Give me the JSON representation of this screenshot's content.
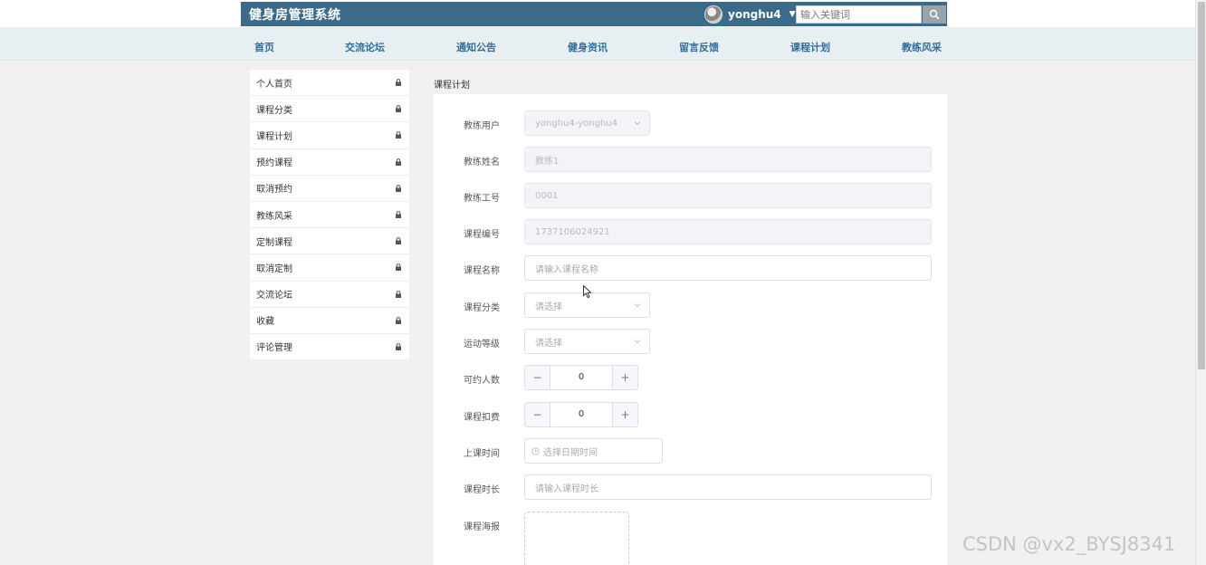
{
  "header": {
    "app_title": "健身房管理系统",
    "username": "yonghu4",
    "search_placeholder": "输入关键词",
    "icons": [
      "avatar",
      "caret-down-icon",
      "search-icon"
    ]
  },
  "nav": {
    "items": [
      "首页",
      "交流论坛",
      "通知公告",
      "健身资讯",
      "留言反馈",
      "课程计划",
      "教练风采"
    ]
  },
  "sidebar": {
    "items": [
      "个人首页",
      "课程分类",
      "课程计划",
      "预约课程",
      "取消预约",
      "教练风采",
      "定制课程",
      "取消定制",
      "交流论坛",
      "收藏",
      "评论管理"
    ],
    "item_icon": "lock-icon"
  },
  "breadcrumb": "课程计划",
  "form": {
    "coach_user": {
      "label": "教练用户",
      "value": "yonghu4-yonghu4"
    },
    "coach_name": {
      "label": "教练姓名",
      "value": "教练1"
    },
    "coach_id": {
      "label": "教练工号",
      "value": "0001"
    },
    "course_no": {
      "label": "课程编号",
      "value": "1737106024921"
    },
    "course_name": {
      "label": "课程名称",
      "placeholder": "请输入课程名称"
    },
    "course_category": {
      "label": "课程分类",
      "placeholder": "请选择"
    },
    "sport_level": {
      "label": "运动等级",
      "placeholder": "请选择"
    },
    "capacity": {
      "label": "可约人数",
      "value": "0",
      "minus": "−",
      "plus": "+"
    },
    "course_fee": {
      "label": "课程扣费",
      "value": "0",
      "minus": "−",
      "plus": "+"
    },
    "class_time": {
      "label": "上课时间",
      "placeholder": "选择日期时间"
    },
    "duration": {
      "label": "课程时长",
      "placeholder": "请输入课程时长"
    },
    "poster": {
      "label": "课程海报"
    }
  },
  "watermark": "CSDN @vx2_BYSJ8341",
  "colors": {
    "header_bg": "#3c6a89",
    "nav_bg": "#e8eff3",
    "nav_text": "#2f6f9c",
    "page_bg": "#f1f1f1"
  }
}
